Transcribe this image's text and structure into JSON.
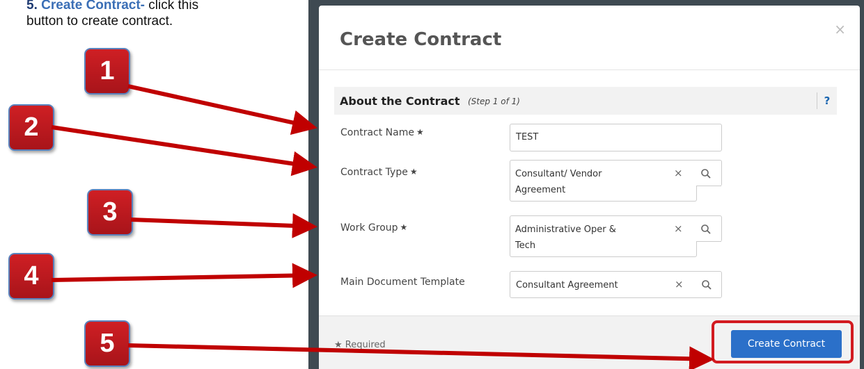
{
  "instruction": {
    "number": "5.",
    "title": "Create Contract-",
    "text_line1": "click this",
    "text_line2": "button to create contract."
  },
  "callouts": [
    "1",
    "2",
    "3",
    "4",
    "5"
  ],
  "modal": {
    "title": "Create Contract",
    "close_icon": "×",
    "section_title": "About the Contract",
    "section_step": "(Step 1 of 1)",
    "help_label": "?",
    "fields": [
      {
        "label": "Contract Name",
        "required": true,
        "value": "TEST"
      },
      {
        "label": "Contract Type",
        "required": true,
        "value_line1": "Consultant/ Vendor",
        "value_line2": "Agreement"
      },
      {
        "label": "Work Group",
        "required": true,
        "value_line1": "Administrative Oper &",
        "value_line2": "Tech"
      },
      {
        "label": "Main Document Template",
        "required": false,
        "value": "Consultant Agreement"
      }
    ],
    "required_star": "★",
    "clear_icon": "×",
    "footer_required": "Required",
    "create_button": "Create Contract"
  },
  "colors": {
    "callout_red": "#c0191f",
    "arrow_red": "#c00000",
    "button_blue": "#2b70c9",
    "instruction_title_blue": "#3b6fb6"
  }
}
